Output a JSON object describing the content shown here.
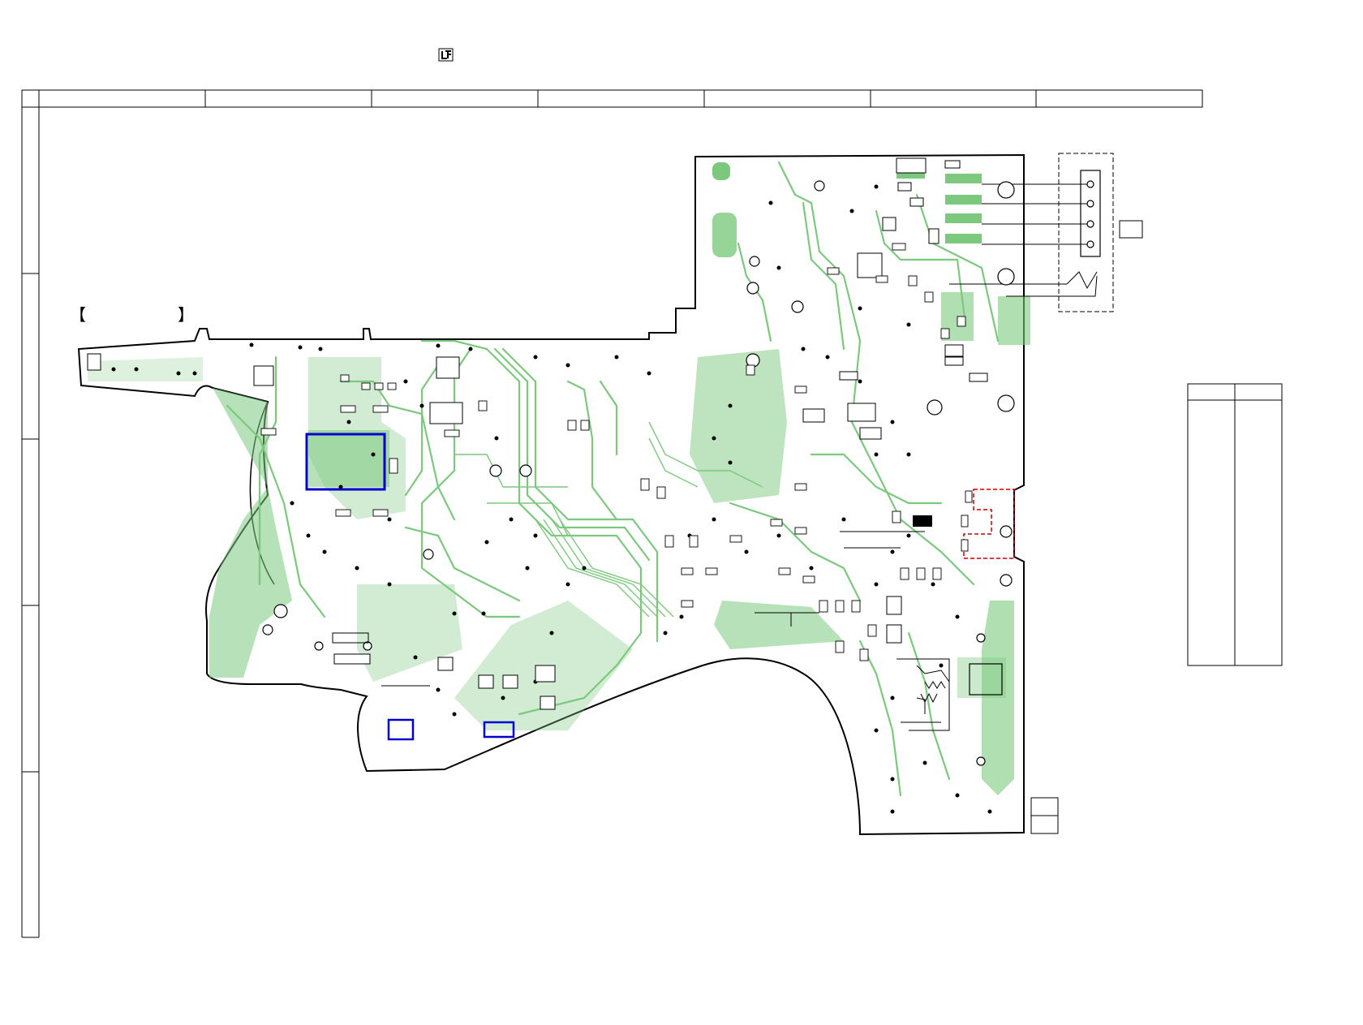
{
  "header": {
    "logo_icon": "lead-free-mark-icon"
  },
  "frame": {
    "columns": 8,
    "rows": 5
  },
  "board": {
    "title_bracket_open": "【",
    "title_bracket_close": "】",
    "colors": {
      "copper": "#7cc97e",
      "outline": "#000000",
      "highlight_blue": "#0000cc",
      "highlight_red": "#cc0000",
      "watermark": "#6b6bd6"
    }
  },
  "table": {
    "columns": 2
  },
  "legend_box": {
    "rows": 2
  }
}
